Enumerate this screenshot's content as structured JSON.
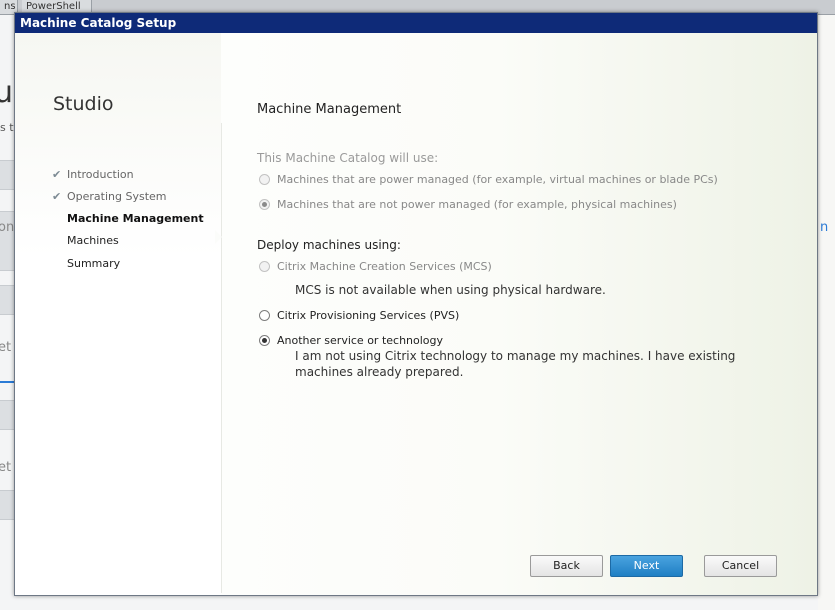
{
  "background": {
    "tabs": [
      "ns",
      "PowerShell"
    ],
    "title_fragment": "u|",
    "subtitle_fragment": "s to",
    "left_fragments": [
      "on",
      "et",
      "et"
    ],
    "right_fragment": "n"
  },
  "dialog": {
    "title": "Machine Catalog Setup",
    "brand": "Studio",
    "steps": [
      {
        "label": "Introduction",
        "completed": true
      },
      {
        "label": "Operating System",
        "completed": true
      },
      {
        "label": "Machine Management",
        "current": true
      },
      {
        "label": "Machines"
      },
      {
        "label": "Summary"
      }
    ],
    "heading": "Machine Management",
    "power": {
      "label": "This Machine Catalog will use:",
      "options": [
        {
          "label": "Machines that are power managed (for example, virtual machines or blade PCs)",
          "selected": false
        },
        {
          "label": "Machines that are not power managed (for example, physical machines)",
          "selected": true
        }
      ]
    },
    "deploy": {
      "label": "Deploy machines using:",
      "mcs_label": "Citrix Machine Creation Services (MCS)",
      "mcs_note": "MCS is not available when using physical hardware.",
      "pvs_label": "Citrix Provisioning Services (PVS)",
      "other_label": "Another service or technology",
      "other_desc": "I am not using Citrix technology to manage my machines. I have existing machines already prepared.",
      "selected": "other"
    },
    "buttons": {
      "back": "Back",
      "next": "Next",
      "cancel": "Cancel"
    },
    "colors": {
      "titlebar": "#0e2a78",
      "primary_button": "#2b8ad0"
    }
  }
}
